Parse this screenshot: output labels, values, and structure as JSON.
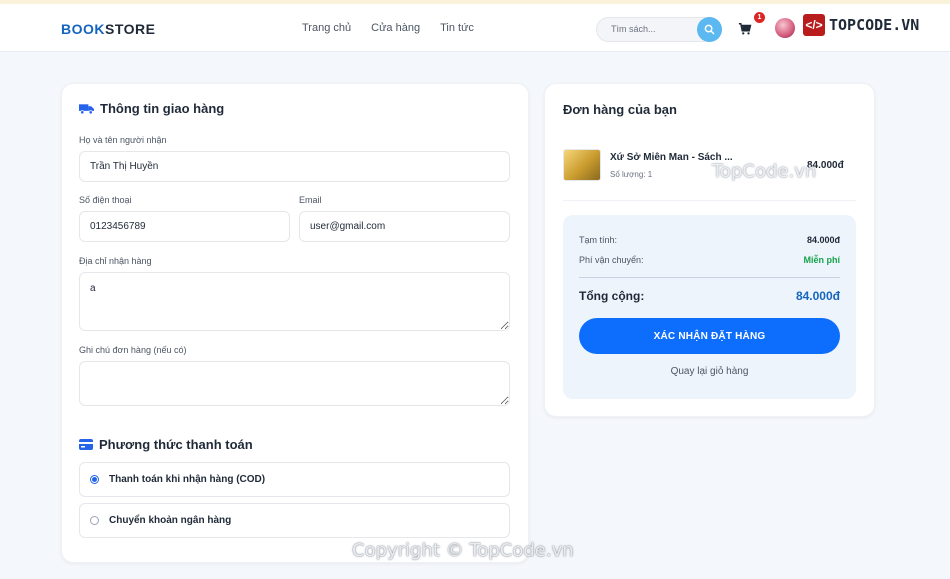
{
  "header": {
    "logo_part1": "BOOK",
    "logo_part2": "STORE",
    "nav": [
      "Trang chủ",
      "Cửa hàng",
      "Tin tức"
    ],
    "search_placeholder": "Tìm sách...",
    "cart_count": "1",
    "brand": "TOPCODE.VN"
  },
  "shipping": {
    "title": "Thông tin giao hàng",
    "name_label": "Họ và tên người nhận",
    "name_value": "Trần Thị Huyền",
    "phone_label": "Số điện thoại",
    "phone_value": "0123456789",
    "email_label": "Email",
    "email_value": "user@gmail.com",
    "address_label": "Địa chỉ nhận hàng",
    "address_value": "a",
    "note_label": "Ghi chú đơn hàng (nếu có)",
    "note_value": ""
  },
  "payment": {
    "title": "Phương thức thanh toán",
    "options": [
      "Thanh toán khi nhận hàng (COD)",
      "Chuyển khoản ngân hàng"
    ],
    "selected": 0
  },
  "order": {
    "title": "Đơn hàng của bạn",
    "item": {
      "name": "Xứ Sở Miên Man - Sách ...",
      "qty": "Số lượng: 1",
      "price": "84.000đ"
    },
    "subtotal_label": "Tạm tính:",
    "subtotal_value": "84.000đ",
    "shipping_label": "Phí vận chuyển:",
    "shipping_value": "Miễn phí",
    "total_label": "Tổng cộng:",
    "total_value": "84.000đ",
    "confirm_label": "XÁC NHẬN ĐẶT HÀNG",
    "back_label": "Quay lại giỏ hàng"
  },
  "watermarks": {
    "w1": "TopCode.vn",
    "w2": "Copyright © TopCode.vn"
  },
  "colors": {
    "primary": "#0d6efd",
    "accent": "#1565c0",
    "free": "#16a34a"
  }
}
